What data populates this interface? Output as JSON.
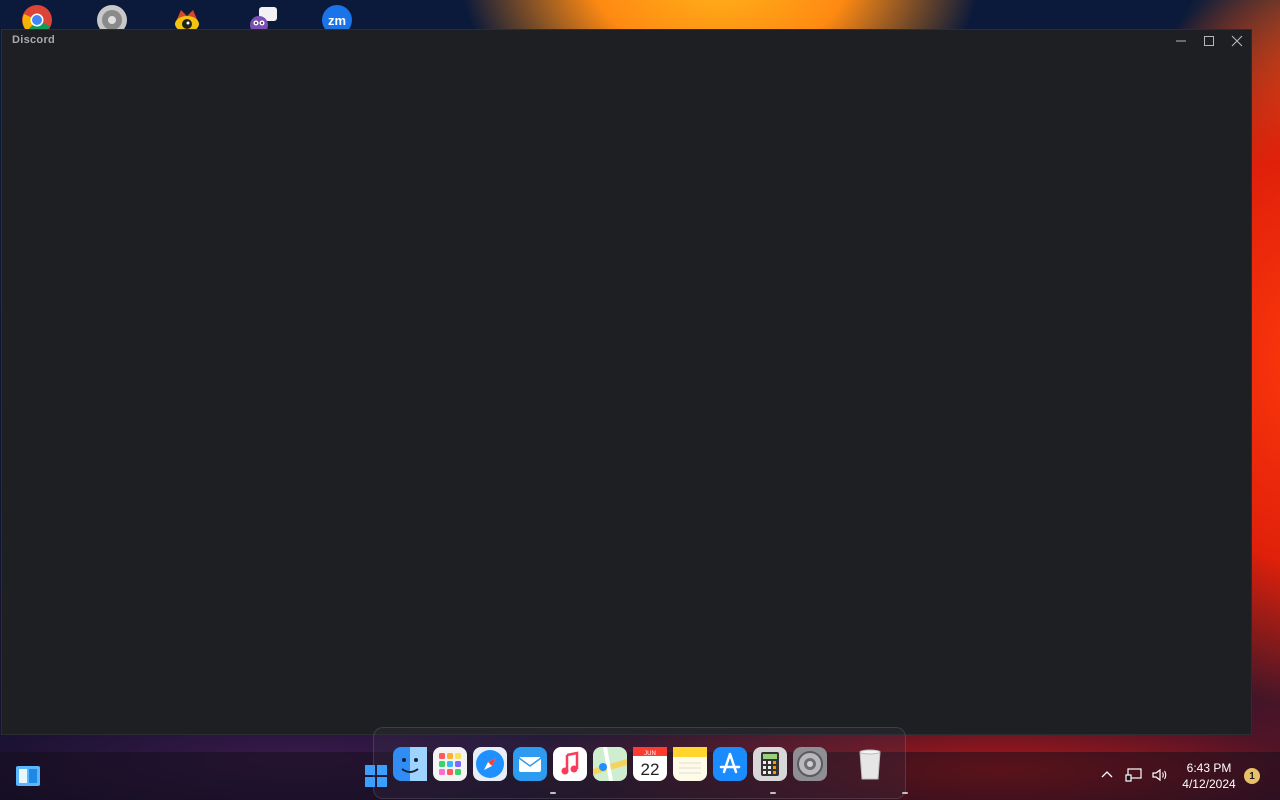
{
  "window": {
    "title": "Discord"
  },
  "desktop_icons": [
    {
      "icon": "chrome-icon"
    },
    {
      "icon": "dvd-player-icon"
    },
    {
      "icon": "eye-app-icon"
    },
    {
      "icon": "chat-bird-icon"
    },
    {
      "icon": "zoom-icon",
      "label": "zm"
    }
  ],
  "dock": {
    "items": [
      {
        "icon": "finder-icon"
      },
      {
        "icon": "launchpad-icon"
      },
      {
        "icon": "safari-icon"
      },
      {
        "icon": "mail-icon"
      },
      {
        "icon": "music-icon"
      },
      {
        "icon": "maps-icon"
      },
      {
        "icon": "calendar-icon",
        "month": "JUN",
        "day": "22"
      },
      {
        "icon": "notes-icon"
      },
      {
        "icon": "app-store-icon"
      },
      {
        "icon": "calculator-icon"
      },
      {
        "icon": "system-settings-icon"
      },
      {
        "icon": "trash-icon"
      }
    ]
  },
  "taskbar": {
    "time": "6:43 PM",
    "date": "4/12/2024",
    "notification_count": "1"
  },
  "colors": {
    "window_bg": "#1e1f22",
    "accent_blue": "#1e90ff"
  }
}
